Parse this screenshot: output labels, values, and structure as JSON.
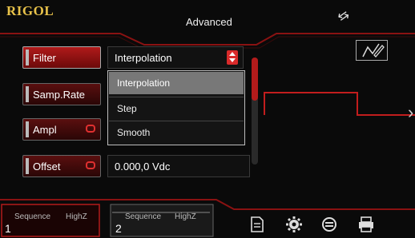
{
  "header": {
    "brand": "RIGOL",
    "title": "Advanced"
  },
  "params": [
    {
      "label": "Filter",
      "active": true,
      "linked": false
    },
    {
      "label": "Samp.Rate",
      "active": false,
      "linked": false
    },
    {
      "label": "Ampl",
      "active": false,
      "linked": true
    },
    {
      "label": "Offset",
      "active": false,
      "linked": true
    }
  ],
  "filter_select": {
    "value": "Interpolation"
  },
  "dropdown": {
    "options": [
      "Interpolation",
      "Step",
      "Smooth"
    ],
    "selected_index": 0
  },
  "offset_value": "0.000,0 Vdc",
  "channels": [
    {
      "number": "1",
      "mode": "Sequence",
      "load": "HighZ"
    },
    {
      "number": "2",
      "mode": "Sequence",
      "load": "HighZ"
    }
  ],
  "colors": {
    "accent": "#b31b1b",
    "brand": "#e8c24a"
  },
  "toolbar_icons": [
    "file-icon",
    "gear-icon",
    "sync-icon",
    "printer-icon"
  ]
}
